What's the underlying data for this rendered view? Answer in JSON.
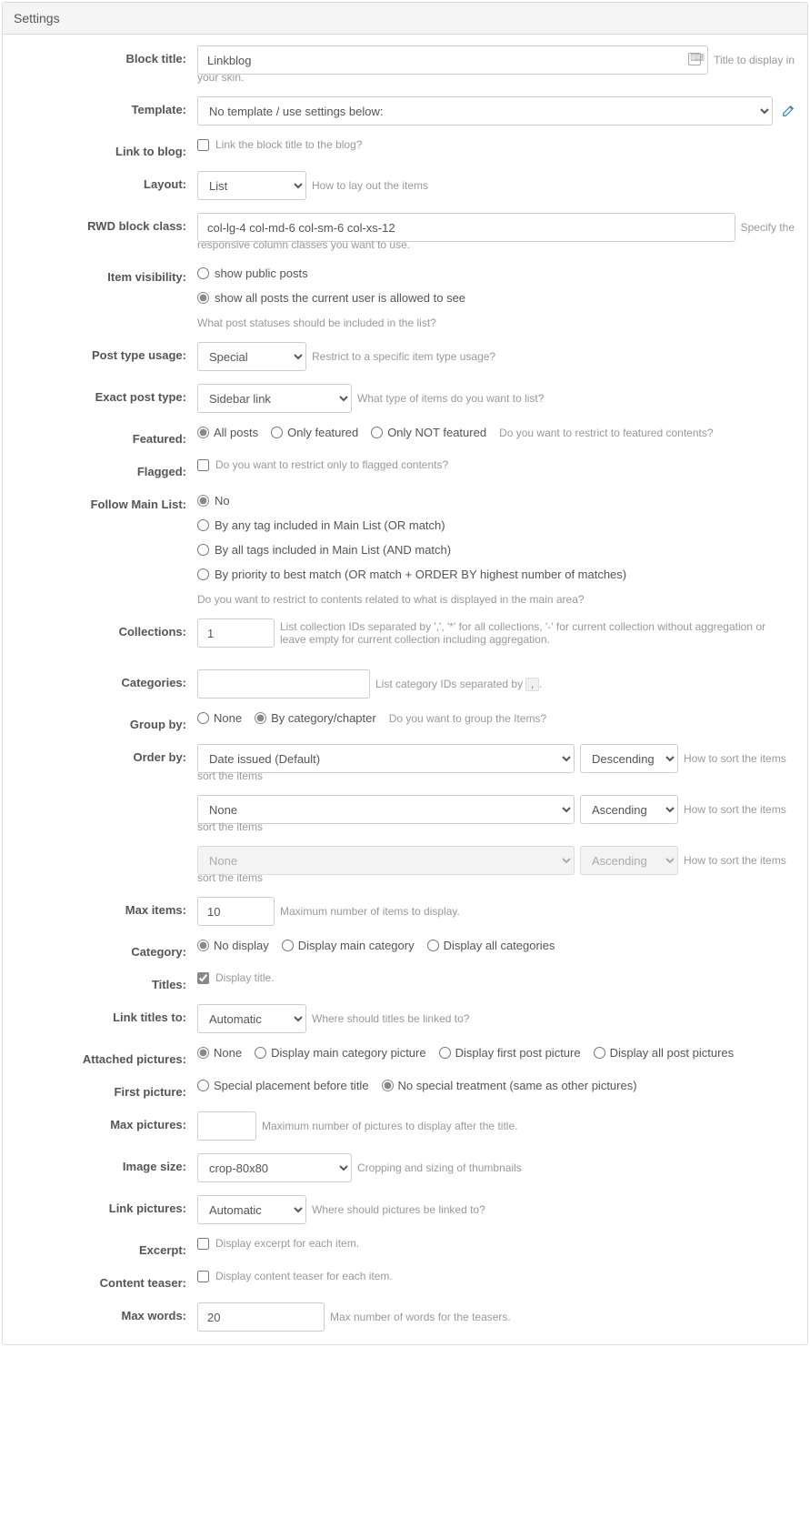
{
  "panel": {
    "title": "Settings"
  },
  "block_title": {
    "label": "Block title:",
    "value": "Linkblog",
    "help": "Title to display in your skin."
  },
  "template": {
    "label": "Template:",
    "value": "No template / use settings below:"
  },
  "link_to_blog": {
    "label": "Link to blog:",
    "help": "Link the block title to the blog?"
  },
  "layout": {
    "label": "Layout:",
    "value": "List",
    "help": "How to lay out the items"
  },
  "rwd": {
    "label": "RWD block class:",
    "value": "col-lg-4 col-md-6 col-sm-6 col-xs-12",
    "help_inline": "Specify the",
    "help_block": "responsive column classes you want to use."
  },
  "item_vis": {
    "label": "Item visibility:",
    "opt1": "show public posts",
    "opt2": "show all posts the current user is allowed to see",
    "help": "What post statuses should be included in the list?"
  },
  "post_type_usage": {
    "label": "Post type usage:",
    "value": "Special",
    "help": "Restrict to a specific item type usage?"
  },
  "exact_post_type": {
    "label": "Exact post type:",
    "value": "Sidebar link",
    "help": "What type of items do you want to list?"
  },
  "featured": {
    "label": "Featured:",
    "opt1": "All posts",
    "opt2": "Only featured",
    "opt3": "Only NOT featured",
    "help": "Do you want to restrict to featured contents?"
  },
  "flagged": {
    "label": "Flagged:",
    "help": "Do you want to restrict only to flagged contents?"
  },
  "follow": {
    "label": "Follow Main List:",
    "opt1": "No",
    "opt2": "By any tag included in Main List (OR match)",
    "opt3": "By all tags included in Main List (AND match)",
    "opt4": "By priority to best match (OR match + ORDER BY highest number of matches)",
    "help": "Do you want to restrict to contents related to what is displayed in the main area?"
  },
  "collections": {
    "label": "Collections:",
    "value": "1",
    "help": "List collection IDs separated by ',', '*' for all collections, '-' for current collection without aggregation or leave empty for current collection including aggregation."
  },
  "categories": {
    "label": "Categories:",
    "help_pre": "List category IDs separated by ",
    "help_post": "."
  },
  "group_by": {
    "label": "Group by:",
    "opt1": "None",
    "opt2": "By category/chapter",
    "help": "Do you want to group the Items?"
  },
  "order_by": {
    "label": "Order by:",
    "row1_field": "Date issued (Default)",
    "row1_dir": "Descending",
    "row2_field": "None",
    "row2_dir": "Ascending",
    "row3_field": "None",
    "row3_dir": "Ascending",
    "help": "How to sort the items"
  },
  "max_items": {
    "label": "Max items:",
    "value": "10",
    "help": "Maximum number of items to display."
  },
  "category": {
    "label": "Category:",
    "opt1": "No display",
    "opt2": "Display main category",
    "opt3": "Display all categories"
  },
  "titles": {
    "label": "Titles:",
    "help": "Display title."
  },
  "link_titles": {
    "label": "Link titles to:",
    "value": "Automatic",
    "help": "Where should titles be linked to?"
  },
  "attached_pics": {
    "label": "Attached pictures:",
    "opt1": "None",
    "opt2": "Display main category picture",
    "opt3": "Display first post picture",
    "opt4": "Display all post pictures"
  },
  "first_picture": {
    "label": "First picture:",
    "opt1": "Special placement before title",
    "opt2": "No special treatment (same as other pictures)"
  },
  "max_pictures": {
    "label": "Max pictures:",
    "help": "Maximum number of pictures to display after the title."
  },
  "image_size": {
    "label": "Image size:",
    "value": "crop-80x80",
    "help": "Cropping and sizing of thumbnails"
  },
  "link_pictures": {
    "label": "Link pictures:",
    "value": "Automatic",
    "help": "Where should pictures be linked to?"
  },
  "excerpt": {
    "label": "Excerpt:",
    "help": "Display excerpt for each item."
  },
  "content_teaser": {
    "label": "Content teaser:",
    "help": "Display content teaser for each item."
  },
  "max_words": {
    "label": "Max words:",
    "value": "20",
    "help": "Max number of words for the teasers."
  }
}
